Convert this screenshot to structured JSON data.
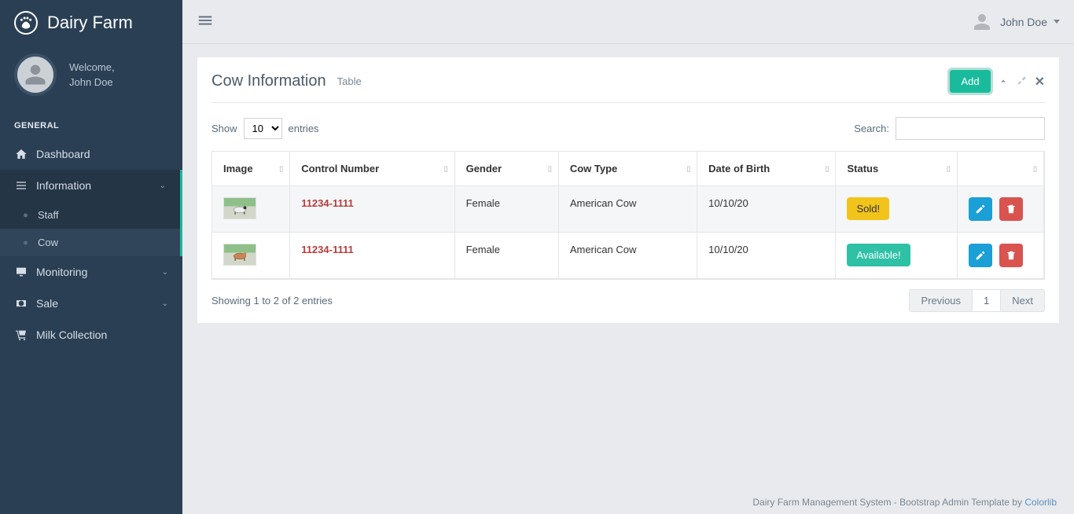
{
  "brand": "Dairy Farm",
  "user": {
    "welcome": "Welcome,",
    "name": "John Doe"
  },
  "sidebar": {
    "section": "GENERAL",
    "items": [
      {
        "label": "Dashboard"
      },
      {
        "label": "Information"
      },
      {
        "label": "Monitoring"
      },
      {
        "label": "Sale"
      },
      {
        "label": "Milk Collection"
      }
    ],
    "info_children": [
      {
        "label": "Staff"
      },
      {
        "label": "Cow"
      }
    ]
  },
  "topbar": {
    "username": "John Doe"
  },
  "panel": {
    "title": "Cow Information",
    "subtitle": "Table",
    "add_label": "Add"
  },
  "table": {
    "show_label_pre": "Show",
    "show_label_post": "entries",
    "entries_value": "10",
    "search_label": "Search:",
    "columns": [
      "Image",
      "Control Number",
      "Gender",
      "Cow Type",
      "Date of Birth",
      "Status",
      ""
    ],
    "rows": [
      {
        "control": "11234-1111",
        "gender": "Female",
        "type": "American Cow",
        "dob": "10/10/20",
        "status": "Sold!",
        "status_kind": "sold"
      },
      {
        "control": "11234-1111",
        "gender": "Female",
        "type": "American Cow",
        "dob": "10/10/20",
        "status": "Available!",
        "status_kind": "available"
      }
    ],
    "info_text": "Showing 1 to 2 of 2 entries",
    "pager": {
      "prev": "Previous",
      "page": "1",
      "next": "Next"
    }
  },
  "footer": {
    "text": "Dairy Farm Management System - Bootstrap Admin Template by ",
    "link": "Colorlib"
  }
}
